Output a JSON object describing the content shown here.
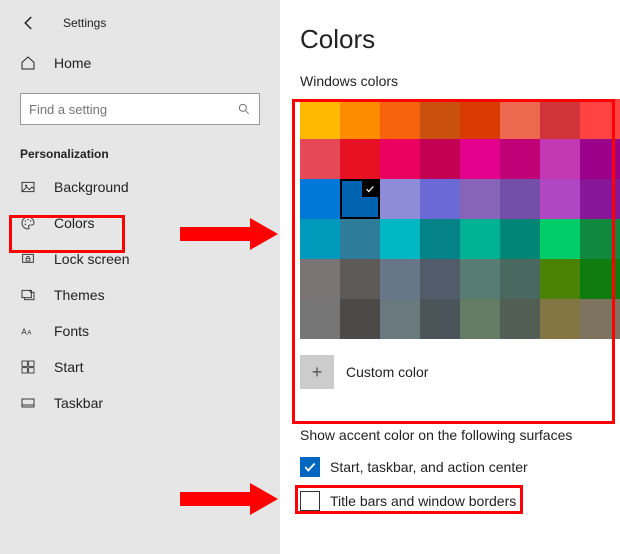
{
  "window": {
    "title": "Settings"
  },
  "sidebar": {
    "home": "Home",
    "search_placeholder": "Find a setting",
    "section": "Personalization",
    "items": [
      {
        "label": "Background"
      },
      {
        "label": "Colors"
      },
      {
        "label": "Lock screen"
      },
      {
        "label": "Themes"
      },
      {
        "label": "Fonts"
      },
      {
        "label": "Start"
      },
      {
        "label": "Taskbar"
      }
    ]
  },
  "main": {
    "title": "Colors",
    "windows_colors_label": "Windows colors",
    "custom_color": "Custom color",
    "accent_heading": "Show accent color on the following surfaces",
    "accent_options": [
      {
        "label": "Start, taskbar, and action center",
        "checked": true
      },
      {
        "label": "Title bars and window borders",
        "checked": false
      }
    ],
    "swatches": [
      "#ffb900",
      "#ff8c00",
      "#f7630c",
      "#ca5010",
      "#da3b01",
      "#ef6950",
      "#d13438",
      "#ff4343",
      "#e74856",
      "#e81123",
      "#ea005e",
      "#c30052",
      "#e3008c",
      "#bf0077",
      "#c239b3",
      "#9a0089",
      "#0078d7",
      "#0063b1",
      "#8e8cd8",
      "#6b69d6",
      "#8764b8",
      "#744da9",
      "#b146c2",
      "#881798",
      "#0099bc",
      "#2d7d9a",
      "#00b7c3",
      "#038387",
      "#00b294",
      "#018574",
      "#00cc6a",
      "#10893e",
      "#7a7574",
      "#5d5a58",
      "#68768a",
      "#515c6b",
      "#567c73",
      "#486860",
      "#498205",
      "#107c10",
      "#767676",
      "#4c4a48",
      "#69797e",
      "#4a5459",
      "#647c64",
      "#525e54",
      "#847545",
      "#7e735f"
    ],
    "selected_swatch_index": 17
  }
}
